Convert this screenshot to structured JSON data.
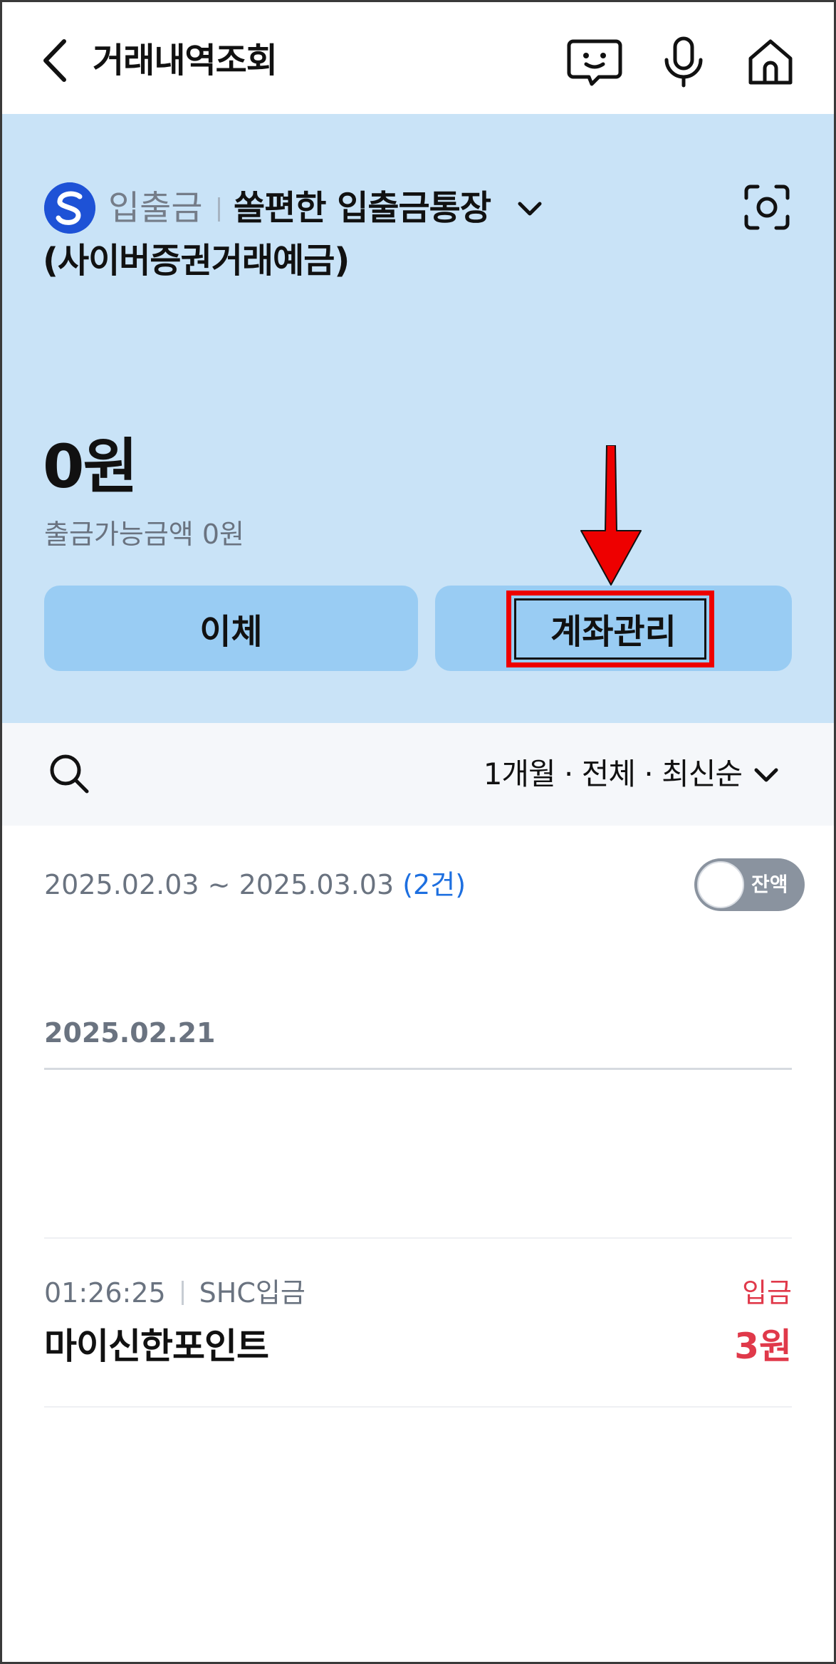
{
  "header": {
    "title": "거래내역조회",
    "icons": [
      "back-icon",
      "chatbot-icon",
      "microphone-icon",
      "home-icon"
    ]
  },
  "account": {
    "type": "입출금",
    "name": "쏠편한 입출금통장",
    "subtitle": "(사이버증권거래예금)",
    "balance": "0원",
    "available": "출금가능금액 0원",
    "logo_letter": "S",
    "colors": {
      "panel_bg": "#c9e3f7",
      "button_bg": "#99ccf3",
      "logo": "#1e52d6"
    }
  },
  "actions": {
    "transfer_label": "이체",
    "manage_label": "계좌관리"
  },
  "filter": {
    "summary": "1개월 · 전체 · 최신순"
  },
  "range": {
    "dates": "2025.02.03 ~ 2025.03.03 ",
    "count": "(2건)",
    "toggle_label": "잔액"
  },
  "transactions": {
    "date": "2025.02.21",
    "items": [
      {
        "time": "01:26:25",
        "category": "SHC입금",
        "type": "입금",
        "description": "마이신한포인트",
        "amount": "3원"
      }
    ]
  },
  "annotation": {
    "highlight_color": "#ee0000"
  }
}
